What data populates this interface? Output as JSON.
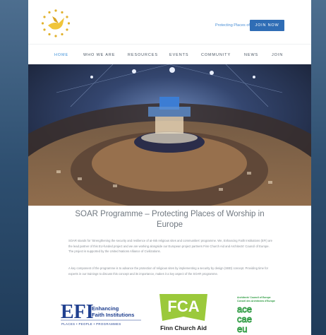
{
  "header": {
    "link_text": "Protecting Places of Worship",
    "join_button": "JOIN NOW"
  },
  "nav": {
    "items": [
      {
        "label": "HOME",
        "active": true
      },
      {
        "label": "WHO WE ARE"
      },
      {
        "label": "RESOURCES"
      },
      {
        "label": "EVENTS"
      },
      {
        "label": "COMMUNITY"
      },
      {
        "label": "NEWS"
      },
      {
        "label": "JOIN"
      }
    ]
  },
  "main": {
    "title_line1": "SOAR Programme – Protecting Places of Worship in",
    "title_line2": "Europe",
    "paragraph1": "SOAR stands for 'Strengthening the security and resilience of at-risk religious sites and communities' programme. We, Enhancing Faith Institutions (EFI) are the lead partner of this EU-funded project and we are working alongside our European project partners Finn Church Aid and Architects' Council of Europe. The project is supported by the United Nations Alliance of Civilizations.",
    "paragraph2": "A key component of the programme is to advance the protection of religious sites by implementing a security by design (SBD) concept. Providing time for experts in our trainings to discuss this concept and its importance, makes it a key aspect of the SOAR programme."
  },
  "partners": {
    "efi": {
      "mark": "EFI",
      "line1": "Enhancing",
      "line2": "Faith Institutions",
      "tagline": "PLACES • PEOPLE • PROGRAMMES"
    },
    "fca": {
      "mark": "FCA",
      "name": "Finn Church Aid"
    },
    "ace": {
      "line1": "Architects' Council of Europe",
      "line2": "Conseil des Architectes d'Europe",
      "mark1": "ace",
      "mark2": "cae",
      "mark3": "eu"
    }
  },
  "colors": {
    "accent": "#2f6db5",
    "nav_active": "#3b8fd8",
    "efi_blue": "#1f3f8f",
    "fca_green": "#9bc93b",
    "ace_green": "#2b9a3f"
  }
}
